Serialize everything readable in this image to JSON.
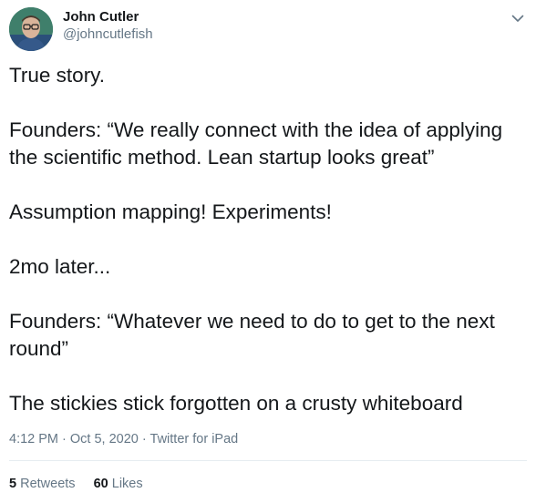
{
  "author": {
    "display_name": "John Cutler",
    "handle": "@johncutlefish",
    "avatar_icon": "profile-photo"
  },
  "menu_icon": "chevron-down-icon",
  "tweet": {
    "paragraphs": [
      "True story.",
      "Founders: “We really connect with the idea of applying the scientific method. Lean startup looks great”",
      "Assumption mapping! Experiments!",
      "2mo later...",
      "Founders: “Whatever we need to do to get to the next round”",
      "The stickies stick forgotten on a crusty whiteboard"
    ]
  },
  "meta": {
    "time": "4:12 PM",
    "separator": "·",
    "date": "Oct 5, 2020",
    "source": "Twitter for iPad"
  },
  "stats": {
    "retweets_count": "5",
    "retweets_label": "Retweets",
    "likes_count": "60",
    "likes_label": "Likes"
  },
  "colors": {
    "text_primary": "#14171a",
    "text_secondary": "#657786",
    "divider": "#e6ecf0"
  }
}
